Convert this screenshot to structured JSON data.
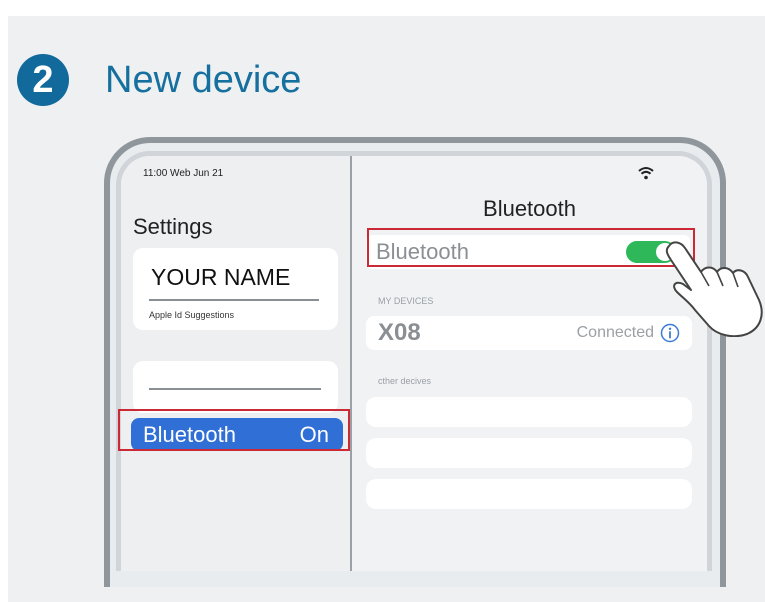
{
  "step": {
    "number": "2",
    "title": "New device"
  },
  "status_bar": {
    "time_date": "11:00 Web Jun 21",
    "wifi_icon": "wifi-icon"
  },
  "left_panel": {
    "title": "Settings",
    "profile": {
      "name": "YOUR NAME",
      "subtitle": "Apple Id Suggestions"
    },
    "bluetooth_row": {
      "label": "Bluetooth",
      "value": "On"
    }
  },
  "right_panel": {
    "title": "Bluetooth",
    "toggle_row": {
      "label": "Bluetooth",
      "enabled": true
    },
    "my_devices_header": "MY DEVICES",
    "devices": [
      {
        "name": "X08",
        "status": "Connected",
        "icon": "info-icon"
      }
    ],
    "other_devices_header": "cther decives",
    "other_devices_placeholders": 3
  },
  "colors": {
    "step_blue": "#126a9c",
    "toggle_green": "#2fb85a",
    "selection_blue": "#2f6fd6",
    "highlight_red": "#cc2936"
  }
}
